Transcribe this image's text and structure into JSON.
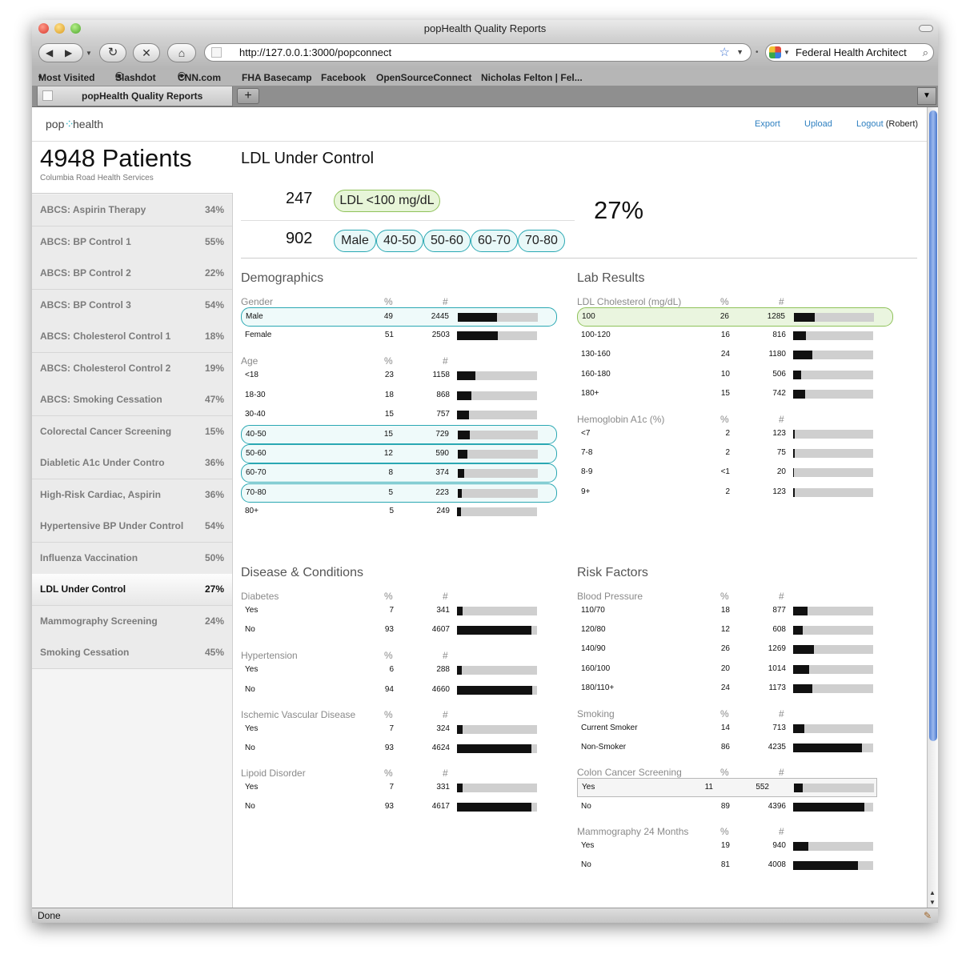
{
  "browser": {
    "window_title": "popHealth Quality Reports",
    "url": "http://127.0.0.1:3000/popconnect",
    "search_text": "Federal Health Architect",
    "bookmarks": [
      "Most Visited",
      "Slashdot",
      "CNN.com",
      "FHA Basecamp",
      "Facebook",
      "OpenSourceConnect",
      "Nicholas Felton | Fel..."
    ],
    "tab_title": "popHealth Quality Reports",
    "new_tab_label": "+",
    "status": "Done"
  },
  "app": {
    "logo": {
      "left": "pop",
      "right": "health"
    },
    "links": {
      "export": "Export",
      "upload": "Upload",
      "logout": "Logout",
      "user": "(Robert)"
    }
  },
  "sidebar": {
    "patients_count": "4948 Patients",
    "org": "Columbia Road Health Services",
    "items": [
      {
        "label": "ABCS: Aspirin Therapy",
        "pct": "34%"
      },
      {
        "label": "ABCS: BP Control 1",
        "pct": "55%"
      },
      {
        "label": "ABCS: BP Control 2",
        "pct": "22%"
      },
      {
        "label": "ABCS: BP Control 3",
        "pct": "54%"
      },
      {
        "label": "ABCS: Cholesterol Control 1",
        "pct": "18%"
      },
      {
        "label": "ABCS: Cholesterol Control 2",
        "pct": "19%"
      },
      {
        "label": "ABCS: Smoking Cessation",
        "pct": "47%"
      },
      {
        "label": "Colorectal Cancer Screening",
        "pct": "15%"
      },
      {
        "label": "Diabletic A1c Under Contro",
        "pct": "36%"
      },
      {
        "label": "High-Risk Cardiac, Aspirin",
        "pct": "36%"
      },
      {
        "label": "Hypertensive BP Under Control",
        "pct": "54%"
      },
      {
        "label": "Influenza Vaccination",
        "pct": "50%"
      },
      {
        "label": "LDL Under Control",
        "pct": "27%",
        "active": true
      },
      {
        "label": "Mammography Screening",
        "pct": "24%"
      },
      {
        "label": "Smoking Cessation",
        "pct": "45%"
      }
    ]
  },
  "report": {
    "title": "LDL Under Control",
    "numerator": "247",
    "numerator_filters": [
      "LDL <100 mg/dL"
    ],
    "denominator": "902",
    "denominator_filters": [
      "Male",
      "40-50",
      "50-60",
      "60-70",
      "70-80"
    ],
    "percent": "27%"
  },
  "sections": {
    "demographics": {
      "title": "Demographics",
      "groups": [
        {
          "name": "Gender",
          "col_pct": "%",
          "col_num": "#",
          "rows": [
            {
              "label": "Male",
              "pct": "49",
              "num": "2445",
              "highlight": "teal"
            },
            {
              "label": "Female",
              "pct": "51",
              "num": "2503"
            }
          ]
        },
        {
          "name": "Age",
          "col_pct": "%",
          "col_num": "#",
          "rows": [
            {
              "label": "<18",
              "pct": "23",
              "num": "1158"
            },
            {
              "label": "18-30",
              "pct": "18",
              "num": "868"
            },
            {
              "label": "30-40",
              "pct": "15",
              "num": "757"
            },
            {
              "label": "40-50",
              "pct": "15",
              "num": "729",
              "highlight": "teal"
            },
            {
              "label": "50-60",
              "pct": "12",
              "num": "590",
              "highlight": "teal"
            },
            {
              "label": "60-70",
              "pct": "8",
              "num": "374",
              "highlight": "teal"
            },
            {
              "label": "70-80",
              "pct": "5",
              "num": "223",
              "highlight": "teal"
            },
            {
              "label": "80+",
              "pct": "5",
              "num": "249"
            }
          ]
        }
      ]
    },
    "lab_results": {
      "title": "Lab Results",
      "groups": [
        {
          "name": "LDL Cholesterol (mg/dL)",
          "col_pct": "%",
          "col_num": "#",
          "rows": [
            {
              "label": "100",
              "pct": "26",
              "num": "1285",
              "highlight": "green"
            },
            {
              "label": "100-120",
              "pct": "16",
              "num": "816"
            },
            {
              "label": "130-160",
              "pct": "24",
              "num": "1180"
            },
            {
              "label": "160-180",
              "pct": "10",
              "num": "506"
            },
            {
              "label": "180+",
              "pct": "15",
              "num": "742"
            }
          ]
        },
        {
          "name": "Hemoglobin A1c (%)",
          "col_pct": "%",
          "col_num": "#",
          "rows": [
            {
              "label": "<7",
              "pct": "2",
              "num": "123"
            },
            {
              "label": "7-8",
              "pct": "2",
              "num": "75"
            },
            {
              "label": "8-9",
              "pct": "<1",
              "num": "20"
            },
            {
              "label": "9+",
              "pct": "2",
              "num": "123"
            }
          ]
        }
      ]
    },
    "disease": {
      "title": "Disease & Conditions",
      "groups": [
        {
          "name": "Diabetes",
          "col_pct": "%",
          "col_num": "#",
          "rows": [
            {
              "label": "Yes",
              "pct": "7",
              "num": "341"
            },
            {
              "label": "No",
              "pct": "93",
              "num": "4607"
            }
          ]
        },
        {
          "name": "Hypertension",
          "col_pct": "%",
          "col_num": "#",
          "rows": [
            {
              "label": "Yes",
              "pct": "6",
              "num": "288"
            },
            {
              "label": "No",
              "pct": "94",
              "num": "4660"
            }
          ]
        },
        {
          "name": "Ischemic Vascular Disease",
          "col_pct": "%",
          "col_num": "#",
          "rows": [
            {
              "label": "Yes",
              "pct": "7",
              "num": "324"
            },
            {
              "label": "No",
              "pct": "93",
              "num": "4624"
            }
          ]
        },
        {
          "name": "Lipoid Disorder",
          "col_pct": "%",
          "col_num": "#",
          "rows": [
            {
              "label": "Yes",
              "pct": "7",
              "num": "331"
            },
            {
              "label": "No",
              "pct": "93",
              "num": "4617"
            }
          ]
        }
      ]
    },
    "risk": {
      "title": "Risk Factors",
      "groups": [
        {
          "name": "Blood Pressure",
          "col_pct": "%",
          "col_num": "#",
          "rows": [
            {
              "label": "110/70",
              "pct": "18",
              "num": "877"
            },
            {
              "label": "120/80",
              "pct": "12",
              "num": "608"
            },
            {
              "label": "140/90",
              "pct": "26",
              "num": "1269"
            },
            {
              "label": "160/100",
              "pct": "20",
              "num": "1014"
            },
            {
              "label": "180/110+",
              "pct": "24",
              "num": "1173"
            }
          ]
        },
        {
          "name": "Smoking",
          "col_pct": "%",
          "col_num": "#",
          "rows": [
            {
              "label": "Current Smoker",
              "pct": "14",
              "num": "713"
            },
            {
              "label": "Non-Smoker",
              "pct": "86",
              "num": "4235"
            }
          ]
        },
        {
          "name": "Colon Cancer Screening",
          "col_pct": "%",
          "col_num": "#",
          "rows": [
            {
              "label": "Yes",
              "pct": "11",
              "num": "552",
              "highlight": "box"
            },
            {
              "label": "No",
              "pct": "89",
              "num": "4396"
            }
          ]
        },
        {
          "name": "Mammography 24 Months",
          "col_pct": "%",
          "col_num": "#",
          "rows": [
            {
              "label": "Yes",
              "pct": "19",
              "num": "940"
            },
            {
              "label": "No",
              "pct": "81",
              "num": "4008"
            }
          ]
        }
      ]
    }
  },
  "colors": {
    "teal": "#2aa8b3",
    "green": "#8fc25a",
    "link": "#2d7fc0",
    "bar_fill": "#111111",
    "bar_track": "#cfcfcf"
  }
}
